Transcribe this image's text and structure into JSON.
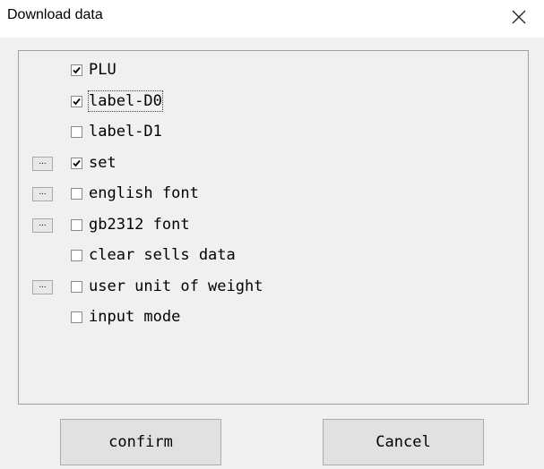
{
  "window": {
    "title": "Download data"
  },
  "more_button_label": "...",
  "items": [
    {
      "label": "PLU",
      "checked": true,
      "has_more_button": false
    },
    {
      "label": "label-D0",
      "checked": true,
      "has_more_button": false,
      "focused": true
    },
    {
      "label": "label-D1",
      "checked": false,
      "has_more_button": false
    },
    {
      "label": "set",
      "checked": true,
      "has_more_button": true
    },
    {
      "label": "english font",
      "checked": false,
      "has_more_button": true
    },
    {
      "label": "gb2312 font",
      "checked": false,
      "has_more_button": true
    },
    {
      "label": "clear sells data",
      "checked": false,
      "has_more_button": false
    },
    {
      "label": "user unit of weight",
      "checked": false,
      "has_more_button": true
    },
    {
      "label": "input mode",
      "checked": false,
      "has_more_button": false
    }
  ],
  "buttons": {
    "confirm": "confirm",
    "cancel": "Cancel"
  }
}
